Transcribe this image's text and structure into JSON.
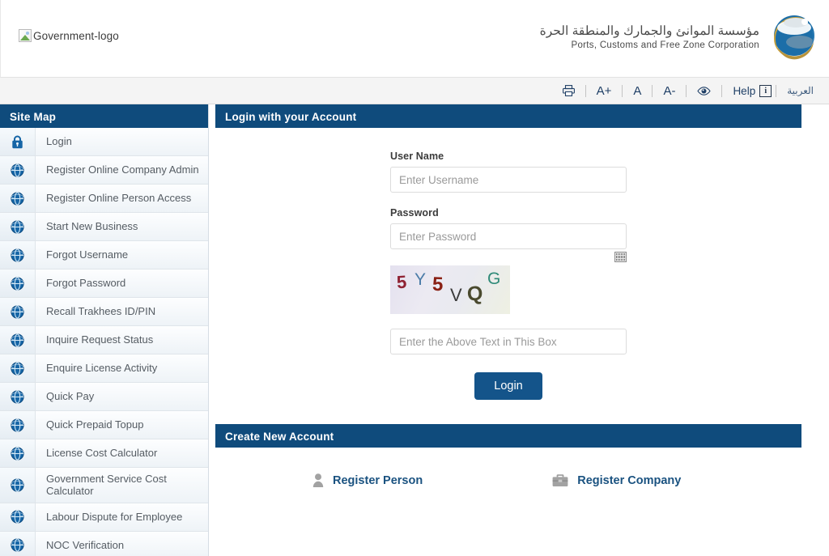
{
  "header": {
    "logo_alt": "Government-logo",
    "logo_icon": "broken-image-icon",
    "corp_name_ar": "مؤسسة الموانئ والجمارك والمنطقة الحرة",
    "corp_name_en": "Ports, Customs and Free Zone Corporation",
    "corp_logo_icon": "globe-swoosh-logo"
  },
  "toolbar": {
    "print_icon": "printer-icon",
    "font_increase": "A+",
    "font_normal": "A",
    "font_decrease": "A-",
    "accessibility_icon": "eye-icon",
    "help_label": "Help",
    "help_info_icon": "info-icon",
    "help_info_glyph": "i",
    "arabic_label": "العربية"
  },
  "sidebar": {
    "title": "Site Map",
    "items": [
      {
        "label": "Login",
        "icon": "lock-icon"
      },
      {
        "label": "Register Online Company Admin",
        "icon": "globe-icon"
      },
      {
        "label": "Register Online Person Access",
        "icon": "globe-icon"
      },
      {
        "label": "Start New Business",
        "icon": "globe-icon"
      },
      {
        "label": "Forgot Username",
        "icon": "globe-icon"
      },
      {
        "label": "Forgot Password",
        "icon": "globe-icon"
      },
      {
        "label": "Recall Trakhees ID/PIN",
        "icon": "globe-icon"
      },
      {
        "label": "Inquire Request Status",
        "icon": "globe-icon"
      },
      {
        "label": "Enquire License Activity",
        "icon": "globe-icon"
      },
      {
        "label": "Quick Pay",
        "icon": "globe-icon"
      },
      {
        "label": "Quick Prepaid Topup",
        "icon": "globe-icon"
      },
      {
        "label": "License Cost Calculator",
        "icon": "globe-icon"
      },
      {
        "label": "Government Service Cost Calculator",
        "icon": "globe-icon"
      },
      {
        "label": "Labour Dispute for Employee",
        "icon": "globe-icon"
      },
      {
        "label": "NOC Verification",
        "icon": "globe-icon"
      }
    ]
  },
  "login_panel": {
    "title": "Login with your Account",
    "username_label": "User Name",
    "username_value": "",
    "username_placeholder": "Enter Username",
    "password_label": "Password",
    "password_value": "",
    "password_placeholder": "Enter Password",
    "virtual_keyboard_icon": "keyboard-icon",
    "captcha_text": "5Y5VQG",
    "captcha_chars": [
      {
        "ch": "5",
        "color": "#8f2233"
      },
      {
        "ch": "Y",
        "color": "#4b7ca8"
      },
      {
        "ch": "5",
        "color": "#8a2014"
      },
      {
        "ch": "V",
        "color": "#3b3b3b"
      },
      {
        "ch": "Q",
        "color": "#4a4a2e"
      },
      {
        "ch": "G",
        "color": "#2f8a78"
      }
    ],
    "captcha_value": "",
    "captcha_placeholder": "Enter the Above Text in This Box",
    "login_button": "Login"
  },
  "create_panel": {
    "title": "Create New Account",
    "links": [
      {
        "label": "Register Person",
        "icon": "person-icon"
      },
      {
        "label": "Register Company",
        "icon": "briefcase-icon"
      }
    ]
  },
  "colors": {
    "panel_header_blue": "#0f4b7c",
    "button_blue": "#14548a",
    "link_blue": "#1a5280",
    "toolbar_icon_blue": "#1f3f66",
    "toolbar_bg": "#f4f4f4"
  }
}
